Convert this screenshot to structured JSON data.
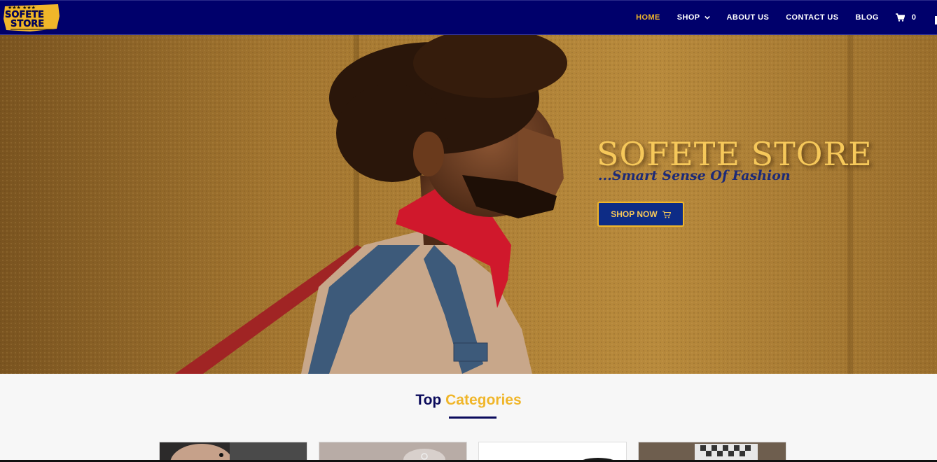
{
  "header": {
    "logo_text_top": "SOFETE",
    "logo_text_bottom": "STORE",
    "nav": [
      {
        "label": "HOME",
        "active": true
      },
      {
        "label": "SHOP",
        "has_dropdown": true
      },
      {
        "label": "ABOUT US"
      },
      {
        "label": "CONTACT US"
      },
      {
        "label": "BLOG"
      }
    ],
    "cart_count": "0"
  },
  "hero": {
    "title": "SOFETE STORE",
    "tagline": "...Smart Sense Of Fashion",
    "button_label": "SHOP NOW"
  },
  "categories": {
    "heading_part1": "Top",
    "heading_part2": "Categories"
  },
  "colors": {
    "navy": "#00006b",
    "gold": "#f0b62a",
    "button_blue": "#0d2c86"
  },
  "icons": [
    "chevron-down-icon",
    "cart-icon",
    "shopping-cart-icon"
  ]
}
